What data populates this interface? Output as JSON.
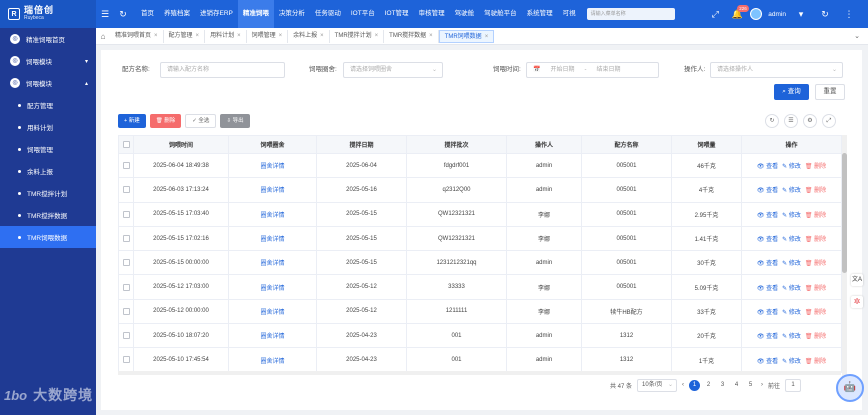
{
  "app": {
    "logo_mark": "R",
    "logo_title": "瑞倍创",
    "logo_subtitle": "Ruybeca"
  },
  "topbar": {
    "nav": [
      "首页",
      "养殖档案",
      "进销存ERP",
      "精准饲喂",
      "决策分析",
      "任务驱动",
      "IOT平台",
      "IOT管理",
      "审核管理",
      "驾驶舱",
      "驾驶舱平台",
      "系统管理",
      "可視"
    ],
    "active_nav_index": 3,
    "search_placeholder": "请输入菜单名称",
    "notification_count": "226",
    "user": "admin"
  },
  "sidebar": {
    "items": [
      {
        "label": "精准饲喂首页",
        "kind": "group"
      },
      {
        "label": "饲喂模块",
        "kind": "group",
        "chevron": "▾"
      },
      {
        "label": "饲喂模块",
        "kind": "group",
        "chevron": "▴"
      },
      {
        "label": "配方管理",
        "kind": "sub"
      },
      {
        "label": "用料计划",
        "kind": "sub"
      },
      {
        "label": "饲喂管理",
        "kind": "sub"
      },
      {
        "label": "余料上报",
        "kind": "sub"
      },
      {
        "label": "TMR搅拌计划",
        "kind": "sub"
      },
      {
        "label": "TMR搅拌数据",
        "kind": "sub"
      },
      {
        "label": "TMR饲喂数据",
        "kind": "sub",
        "active": true
      }
    ]
  },
  "tabs": [
    {
      "label": "精准饲喂首页"
    },
    {
      "label": "配方管理"
    },
    {
      "label": "用料计划"
    },
    {
      "label": "饲喂管理"
    },
    {
      "label": "余料上报"
    },
    {
      "label": "TMR搅拌计划"
    },
    {
      "label": "TMR搅拌数据"
    },
    {
      "label": "TMR饲喂数据",
      "active": true
    }
  ],
  "filters": {
    "recipe_label": "配方名称:",
    "recipe_placeholder": "请输入配方名称",
    "barn_label": "饲喂圈舍:",
    "barn_placeholder": "请选择饲喂圈舍",
    "time_label": "饲喂时间:",
    "start_placeholder": "开始日期",
    "range_sep": "-",
    "end_placeholder": "结束日期",
    "operator_label": "操作人:",
    "operator_placeholder": "请选择操作人",
    "query_label": "查询",
    "reset_label": "重置"
  },
  "toolbar": {
    "add": "+ 新建",
    "delete": "删除",
    "select_all": "全选",
    "export": "导出"
  },
  "table": {
    "columns": [
      "饲喂时间",
      "饲喂圈舍",
      "搅拌日期",
      "搅拌批次",
      "操作人",
      "配方名称",
      "饲喂量",
      "操作"
    ],
    "detail_link": "圈舍详情",
    "op_view": "查看",
    "op_edit": "修改",
    "op_delete": "删除",
    "rows": [
      {
        "time": "2025-06-04 18:49:38",
        "date": "2025-06-04",
        "batch": "fdgdrf001",
        "operator": "admin",
        "recipe": "005001",
        "amount": "46千克"
      },
      {
        "time": "2025-06-03 17:13:24",
        "date": "2025-05-16",
        "batch": "q2312Q00",
        "operator": "admin",
        "recipe": "005001",
        "amount": "4千克"
      },
      {
        "time": "2025-05-15 17:03:40",
        "date": "2025-05-15",
        "batch": "QW12321321",
        "operator": "李娜",
        "recipe": "005001",
        "amount": "2.95千克"
      },
      {
        "time": "2025-05-15 17:02:16",
        "date": "2025-05-15",
        "batch": "QW12321321",
        "operator": "李娜",
        "recipe": "005001",
        "amount": "1.41千克"
      },
      {
        "time": "2025-05-15 00:00:00",
        "date": "2025-05-15",
        "batch": "1231212321qq",
        "operator": "admin",
        "recipe": "005001",
        "amount": "30千克"
      },
      {
        "time": "2025-05-12 17:03:00",
        "date": "2025-05-12",
        "batch": "33333",
        "operator": "李娜",
        "recipe": "005001",
        "amount": "5.09千克"
      },
      {
        "time": "2025-05-12 00:00:00",
        "date": "2025-05-12",
        "batch": "1211111",
        "operator": "李娜",
        "recipe": "犊牛HB配方",
        "amount": "33千克"
      },
      {
        "time": "2025-05-10 18:07:20",
        "date": "2025-04-23",
        "batch": "001",
        "operator": "admin",
        "recipe": "1312",
        "amount": "20千克"
      },
      {
        "time": "2025-05-10 17:45:54",
        "date": "2025-04-23",
        "batch": "001",
        "operator": "admin",
        "recipe": "1312",
        "amount": "1千克"
      }
    ]
  },
  "pagination": {
    "total": "共 47 条",
    "page_size": "10条/页",
    "pages": [
      "1",
      "2",
      "3",
      "4",
      "5"
    ],
    "current_page": "1",
    "goto_label": "前往",
    "goto_value": "1"
  },
  "watermark": {
    "logo": "1bo",
    "text": "大数跨境"
  },
  "colors": {
    "primary": "#1e63d9",
    "sidebar": "#1f3a93",
    "danger": "#f56c6c"
  }
}
